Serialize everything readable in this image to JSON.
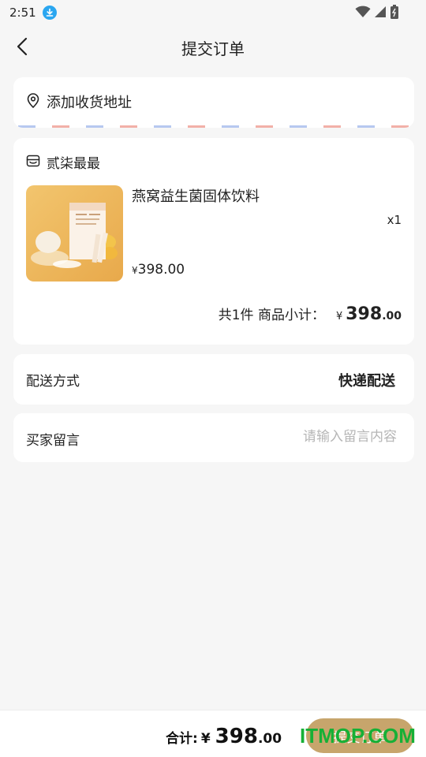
{
  "status_bar": {
    "time": "2:51"
  },
  "header": {
    "title": "提交订单"
  },
  "address": {
    "label": "添加收货地址"
  },
  "order": {
    "shop_name": "贰柒最最",
    "product": {
      "name": "燕窝益生菌固体饮料",
      "quantity": "x1",
      "currency": "¥",
      "price": "398.00"
    },
    "subtotal": {
      "label": "共1件 商品小计：",
      "currency": "¥",
      "integer": "398",
      "decimal": ".00"
    }
  },
  "delivery": {
    "label": "配送方式",
    "value": "快递配送"
  },
  "message": {
    "label": "买家留言",
    "placeholder": "请输入留言内容"
  },
  "footer": {
    "total_label": "合计:",
    "currency": "¥",
    "integer": "398",
    "decimal": ".00",
    "submit_label": "提交订单"
  },
  "watermark": "ITMOP.COM",
  "colors": {
    "accent": "#c7a56c",
    "stripe_blue": "#b7c8f0",
    "stripe_red": "#f2b0a8",
    "watermark": "#16b036"
  }
}
